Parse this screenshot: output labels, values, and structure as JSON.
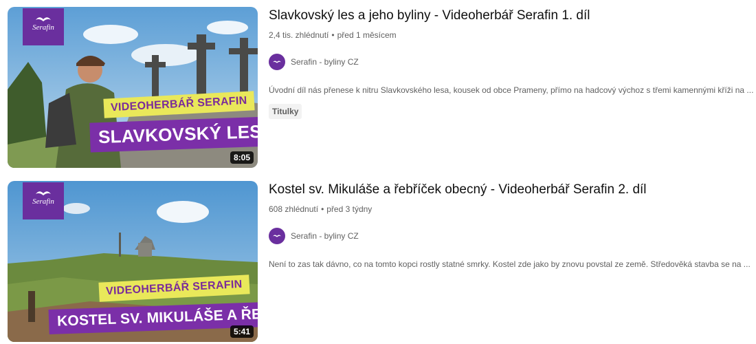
{
  "videos": [
    {
      "title": "Slavkovský les a jeho byliny - Videoherbář Serafin 1. díl",
      "views": "2,4 tis. zhlédnutí",
      "age": "před 1 měsícem",
      "channel": "Serafin - byliny CZ",
      "description": "Úvodní díl nás přenese k nitru Slavkovského lesa, kousek od obce Prameny, přímo na hadcový výchoz s třemi kamennými kříži na ...",
      "badge": "Titulky",
      "duration": "8:05",
      "thumb_logo": "Serafin",
      "thumb_band_top": "VIDEOHERBÁŘ SERAFIN",
      "thumb_band_main": "SLAVKOVSKÝ LES"
    },
    {
      "title": "Kostel sv. Mikuláše a řebříček obecný - Videoherbář Serafin 2. díl",
      "views": "608 zhlédnutí",
      "age": "před 3 týdny",
      "channel": "Serafin - byliny CZ",
      "description": "Není to zas tak dávno, co na tomto kopci rostly statné smrky. Kostel zde jako by znovu povstal ze země. Středověká stavba se na ...",
      "duration": "5:41",
      "thumb_logo": "Serafin",
      "thumb_band_top": "VIDEOHERBÁŘ SERAFIN",
      "thumb_band_main": "KOSTEL SV. MIKULÁŠE A ŘEBŘÍČEK"
    }
  ],
  "separator": "•",
  "colors": {
    "brand_purple": "#6a2f9e",
    "band_yellow": "#e9e85a",
    "text_secondary": "#606060"
  }
}
